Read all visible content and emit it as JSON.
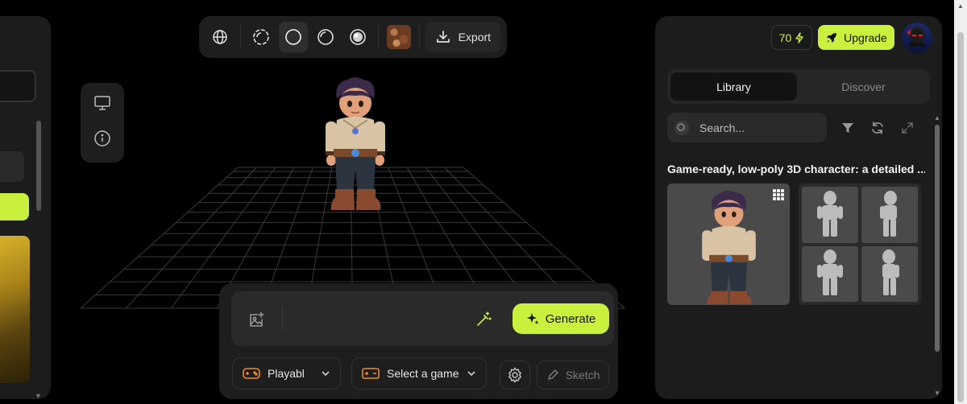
{
  "toolbar": {
    "export_label": "Export",
    "icons": [
      "globe-icon",
      "shading-icon-1",
      "shading-icon-2",
      "shading-icon-3",
      "shading-icon-4",
      "texture-thumbnail",
      "download-icon"
    ]
  },
  "vertical_toolbar": {
    "icons": [
      "monitor-icon",
      "info-icon"
    ]
  },
  "prompt": {
    "input_value": "",
    "generate_label": "Generate",
    "mode_dropdown": "Playabl",
    "game_dropdown": "Select a game",
    "sketch_label": "Sketch"
  },
  "header": {
    "credits": "70",
    "upgrade_label": "Upgrade"
  },
  "tabs": [
    {
      "label": "Library",
      "active": true
    },
    {
      "label": "Discover",
      "active": false
    }
  ],
  "search": {
    "placeholder": "Search..."
  },
  "library": {
    "item_title": "Game-ready, low-poly 3D character: a detailed ..."
  },
  "colors": {
    "accent": "#c8f03c",
    "background": "#000000",
    "panel": "#1c1c1c"
  }
}
